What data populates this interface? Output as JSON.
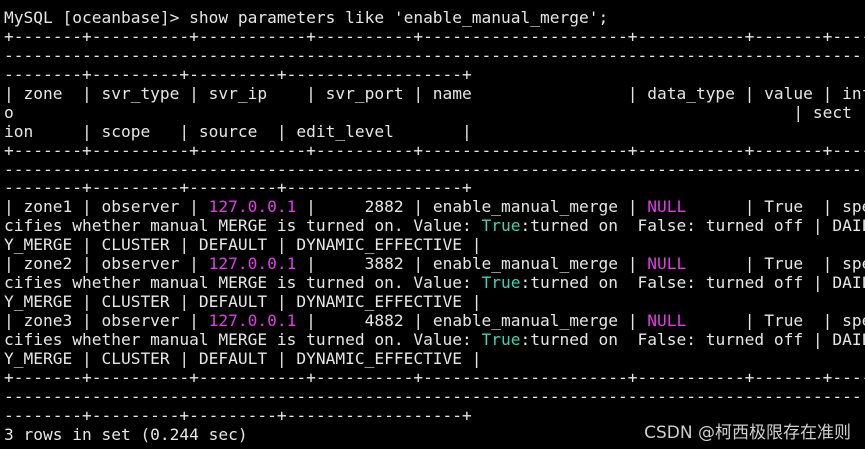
{
  "terminal": {
    "lines": [
      [
        {
          "text": "MySQL [oceanbase]> show parameters like 'enable_manual_merge';"
        }
      ],
      [
        {
          "text": "+-------+----------+-----------+----------+---------------------+-----------+-------+----"
        }
      ],
      [
        {
          "text": "----------------------------------------------------------------------------------------"
        }
      ],
      [
        {
          "text": "--------+---------+---------+------------------+"
        }
      ],
      [
        {
          "text": "| zone  | svr_type | svr_ip    | svr_port | name                | data_type | value | inf"
        }
      ],
      [
        {
          "text": "o                                                                                | sect"
        }
      ],
      [
        {
          "text": "ion     | scope   | source  | edit_level       |"
        }
      ],
      [
        {
          "text": "+-------+----------+-----------+----------+---------------------+-----------+-------+----"
        }
      ],
      [
        {
          "text": "----------------------------------------------------------------------------------------"
        }
      ],
      [
        {
          "text": "--------+---------+---------+------------------+"
        }
      ],
      [
        {
          "text": "| zone1 | observer | "
        },
        {
          "text": "127.0.0.1",
          "color": "magenta"
        },
        {
          "text": " |     2882 | enable_manual_merge | "
        },
        {
          "text": "NULL",
          "color": "magenta"
        },
        {
          "text": "      | True  | spe"
        }
      ],
      [
        {
          "text": "cifies whether manual MERGE is turned on. Value: "
        },
        {
          "text": "True",
          "color": "green"
        },
        {
          "text": ":turned on  False: turned off | DAIL"
        }
      ],
      [
        {
          "text": "Y_MERGE | CLUSTER | DEFAULT | DYNAMIC_EFFECTIVE |"
        }
      ],
      [
        {
          "text": "| zone2 | observer | "
        },
        {
          "text": "127.0.0.1",
          "color": "magenta"
        },
        {
          "text": " |     3882 | enable_manual_merge | "
        },
        {
          "text": "NULL",
          "color": "magenta"
        },
        {
          "text": "      | True  | spe"
        }
      ],
      [
        {
          "text": "cifies whether manual MERGE is turned on. Value: "
        },
        {
          "text": "True",
          "color": "green"
        },
        {
          "text": ":turned on  False: turned off | DAIL"
        }
      ],
      [
        {
          "text": "Y_MERGE | CLUSTER | DEFAULT | DYNAMIC_EFFECTIVE |"
        }
      ],
      [
        {
          "text": "| zone3 | observer | "
        },
        {
          "text": "127.0.0.1",
          "color": "magenta"
        },
        {
          "text": " |     4882 | enable_manual_merge | "
        },
        {
          "text": "NULL",
          "color": "magenta"
        },
        {
          "text": "      | True  | spe"
        }
      ],
      [
        {
          "text": "cifies whether manual MERGE is turned on. Value: "
        },
        {
          "text": "True",
          "color": "green"
        },
        {
          "text": ":turned on  False: turned off | DAIL"
        }
      ],
      [
        {
          "text": "Y_MERGE | CLUSTER | DEFAULT | DYNAMIC_EFFECTIVE |"
        }
      ],
      [
        {
          "text": "+-------+----------+-----------+----------+---------------------+-----------+-------+----"
        }
      ],
      [
        {
          "text": "----------------------------------------------------------------------------------------"
        }
      ],
      [
        {
          "text": "--------+---------+---------+------------------+"
        }
      ],
      [
        {
          "text": "3 rows in set (0.244 sec)"
        }
      ]
    ]
  },
  "watermark": "CSDN @柯西极限存在准则",
  "colors": {
    "background": "#000000",
    "text": "#e6e6e6",
    "magenta": "#e13be4",
    "green": "#3fd3b0"
  }
}
